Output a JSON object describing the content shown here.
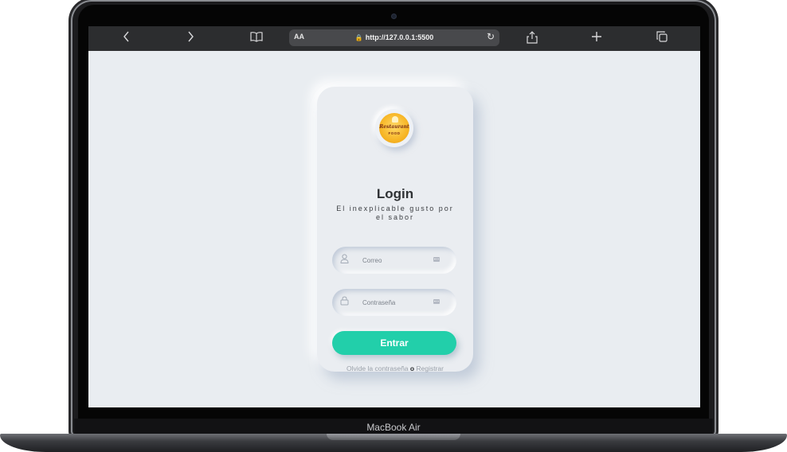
{
  "browser": {
    "back_icon": "chevron-left-icon",
    "forward_icon": "chevron-right-icon",
    "bookmarks_icon": "book-icon",
    "url_aa": "AA",
    "url": "http://127.0.0.1:5500",
    "reload_icon": "reload-icon",
    "share_icon": "share-icon",
    "new_tab_icon": "plus-icon",
    "tabs_icon": "tabs-icon"
  },
  "login": {
    "logo_text": "Restaurant",
    "logo_subtext": "FOOD",
    "title": "Login",
    "subtitle": "El inexplicable gusto por el sabor",
    "email_placeholder": "Correo",
    "password_placeholder": "Contraseña",
    "submit_label": "Entrar",
    "forgot_label": "Olvide la contraseña",
    "separator": "o",
    "register_label": "Registrar",
    "accent_color": "#22cfaa"
  },
  "device": {
    "brand_label": "MacBook Air"
  }
}
